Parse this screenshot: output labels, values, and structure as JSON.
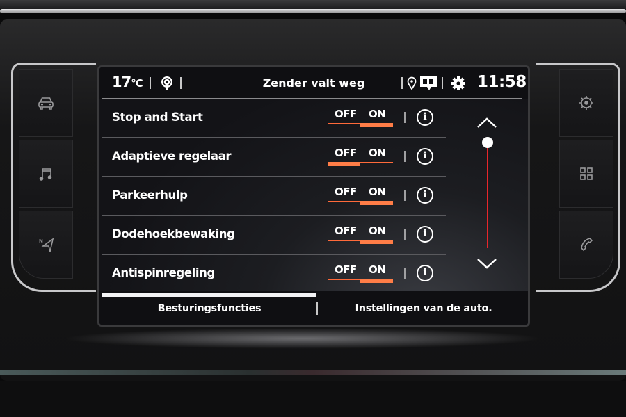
{
  "statusbar": {
    "temperature": "17",
    "temperature_unit": "°C",
    "radio_icon": "broadcast-icon",
    "station_text": "Zender valt weg",
    "icons": [
      "location-pin-icon",
      "message-icon",
      "settings-gear-icon"
    ],
    "clock": "11:58"
  },
  "settings": [
    {
      "label": "Stop and Start",
      "off_label": "OFF",
      "on_label": "ON",
      "state": "ON"
    },
    {
      "label": "Adaptieve regelaar",
      "off_label": "OFF",
      "on_label": "ON",
      "state": "OFF"
    },
    {
      "label": "Parkeerhulp",
      "off_label": "OFF",
      "on_label": "ON",
      "state": "ON"
    },
    {
      "label": "Dodehoekbewaking",
      "off_label": "OFF",
      "on_label": "ON",
      "state": "ON"
    },
    {
      "label": "Antispinregeling",
      "off_label": "OFF",
      "on_label": "ON",
      "state": "ON"
    }
  ],
  "scrollbar": {
    "position": 0.0
  },
  "tabs": [
    {
      "label": "Besturingsfuncties",
      "active": true
    },
    {
      "label": "Instellingen van de auto.",
      "active": false
    }
  ],
  "hardware_buttons": {
    "left": [
      "car-icon",
      "music-note-icon",
      "navigation-icon"
    ],
    "right": [
      "settings-icon",
      "apps-grid-icon",
      "phone-icon"
    ]
  },
  "colors": {
    "accent": "#ff7d47",
    "scroll_track": "#e8262b",
    "text": "#ffffff",
    "background": "#131317"
  }
}
